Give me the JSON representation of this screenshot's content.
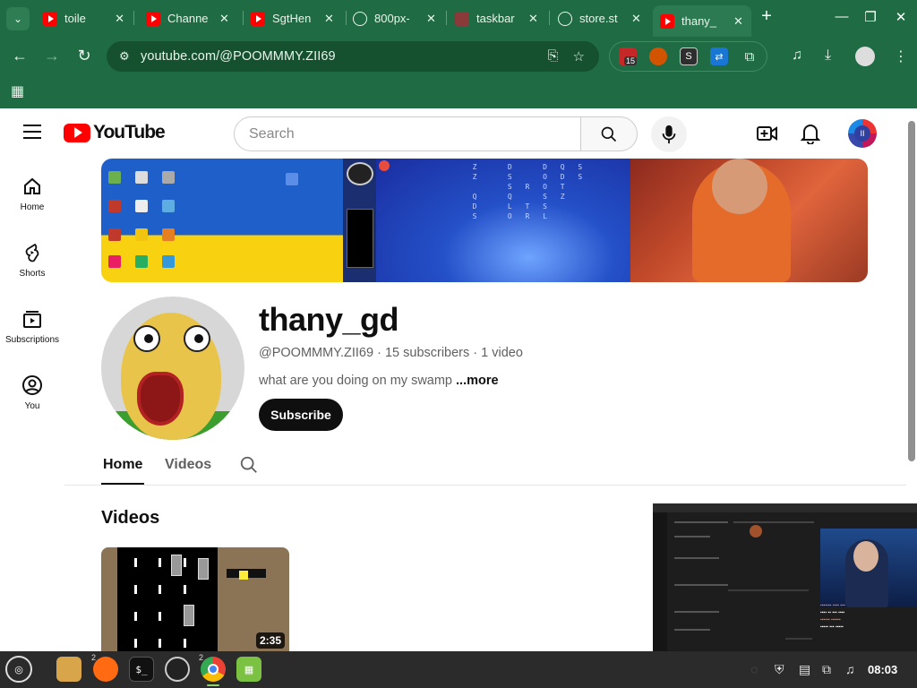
{
  "browser": {
    "tabs": [
      {
        "title": "toile",
        "favicon": "youtube-icon"
      },
      {
        "title": "Channe",
        "favicon": "youtube-icon"
      },
      {
        "title": "SgtHen",
        "favicon": "youtube-icon"
      },
      {
        "title": "800px-",
        "favicon": "globe-icon"
      },
      {
        "title": "taskbar",
        "favicon": "image-icon"
      },
      {
        "title": "store.st",
        "favicon": "globe-icon"
      },
      {
        "title": "thany_",
        "favicon": "youtube-icon",
        "active": true
      }
    ],
    "url": "youtube.com/@POOMMMY.ZII69",
    "extension_badge": "15"
  },
  "youtube": {
    "logo_text": "YouTube",
    "search_placeholder": "Search",
    "guide": [
      {
        "label": "Home",
        "icon": "home-icon"
      },
      {
        "label": "Shorts",
        "icon": "shorts-icon"
      },
      {
        "label": "Subscriptions",
        "icon": "subscriptions-icon"
      },
      {
        "label": "You",
        "icon": "you-icon"
      }
    ],
    "channel": {
      "name": "thany_gd",
      "handle": "@POOMMMY.ZII69",
      "subscribers": "15 subscribers",
      "video_count": "1 video",
      "separator": "·",
      "description": "what are you doing on my swamp",
      "more_label": "...more",
      "subscribe_label": "Subscribe"
    },
    "channel_tabs": [
      "Home",
      "Videos"
    ],
    "section_title": "Videos",
    "video": {
      "duration": "2:35"
    }
  },
  "taskbar": {
    "firefox_count": "2",
    "chrome_count": "2",
    "clock": "08:03"
  },
  "colors": {
    "chrome_green": "#1e6b44",
    "yt_red": "#ff0000",
    "subscribe_bg": "#0f0f0f",
    "taskbar_bg": "#2b2b2b"
  }
}
